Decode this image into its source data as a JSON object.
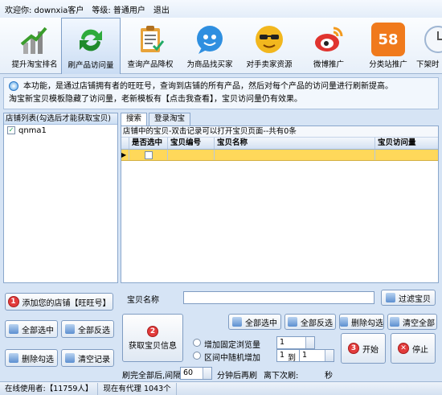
{
  "topbar": {
    "welcome": "欢迎你: downxia客户",
    "level": "等级: 普通用户",
    "logout": "退出"
  },
  "toolbar": [
    {
      "label": "提升淘宝排名",
      "icon": "bar-chart-icon",
      "color": "#6aa84f"
    },
    {
      "label": "刷产品访问量",
      "icon": "green-arrows-icon",
      "color": "#2eaa3c"
    },
    {
      "label": "查询产品降权",
      "icon": "clipboard-icon",
      "color": "#e8a33a"
    },
    {
      "label": "为商品找买家",
      "icon": "chat-bubble-icon",
      "color": "#2f8fe0"
    },
    {
      "label": "对手卖家资源",
      "icon": "sunglasses-smiley-icon",
      "color": "#f2b71e"
    },
    {
      "label": "微博推广",
      "icon": "weibo-icon",
      "color": "#e0342f"
    },
    {
      "label": "分类站推广",
      "icon": "58-icon",
      "color": "#f07a1c",
      "text": "58"
    },
    {
      "label": "下架时",
      "icon": "clock-icon",
      "color": "#9fb6d3"
    }
  ],
  "info": {
    "line1": "本功能，是通过店铺拥有者的旺旺号，查询到店铺的所有产品，然后对每个产品的访问量进行刷新提高。",
    "line2": "淘宝新宝贝模板隐藏了访问量，老新模板有【点击我查看】，宝贝访问量仍有效果。"
  },
  "shop_list": {
    "header": "店铺列表(勾选后才能获取宝贝)",
    "items": [
      {
        "name": "qnma1",
        "checked": true
      }
    ]
  },
  "left_buttons": {
    "add_shop": "添加您的店铺【旺旺号】",
    "select_all": "全部选中",
    "invert": "全部反选",
    "delete_checked": "删除勾选",
    "clear_records": "清空记录"
  },
  "tabs": [
    {
      "label": "搜索",
      "active": true
    },
    {
      "label": "登录淘宝",
      "active": false
    }
  ],
  "grid": {
    "caption": "店铺中的宝贝-双击记录可以打开宝贝页面--共有0条",
    "columns": [
      "是否选中",
      "宝贝编号",
      "宝贝名称",
      "宝贝访问量"
    ]
  },
  "bottom": {
    "product_name_label": "宝贝名称",
    "filter_button": "过滤宝贝",
    "get_info_button": "获取宝贝信息",
    "select_all": "全部选中",
    "invert": "全部反选",
    "delete_checked": "删除勾选",
    "clear_all": "清空全部",
    "radio_fixed": "增加固定浏览量",
    "radio_random": "区间中随机增加",
    "fixed_value": "1",
    "random_from": "1",
    "to_label": "到",
    "random_to": "1",
    "start": "开始",
    "stop": "停止",
    "refresh_label": "刷完全部后,间隔",
    "interval_value": "60",
    "interval_unit": "分钟后再刷",
    "next_label": "离下次刷:",
    "seconds_label": "秒"
  },
  "status": {
    "online": "在线使用者:【11759人】",
    "proxies": "现在有代理 1043个"
  }
}
